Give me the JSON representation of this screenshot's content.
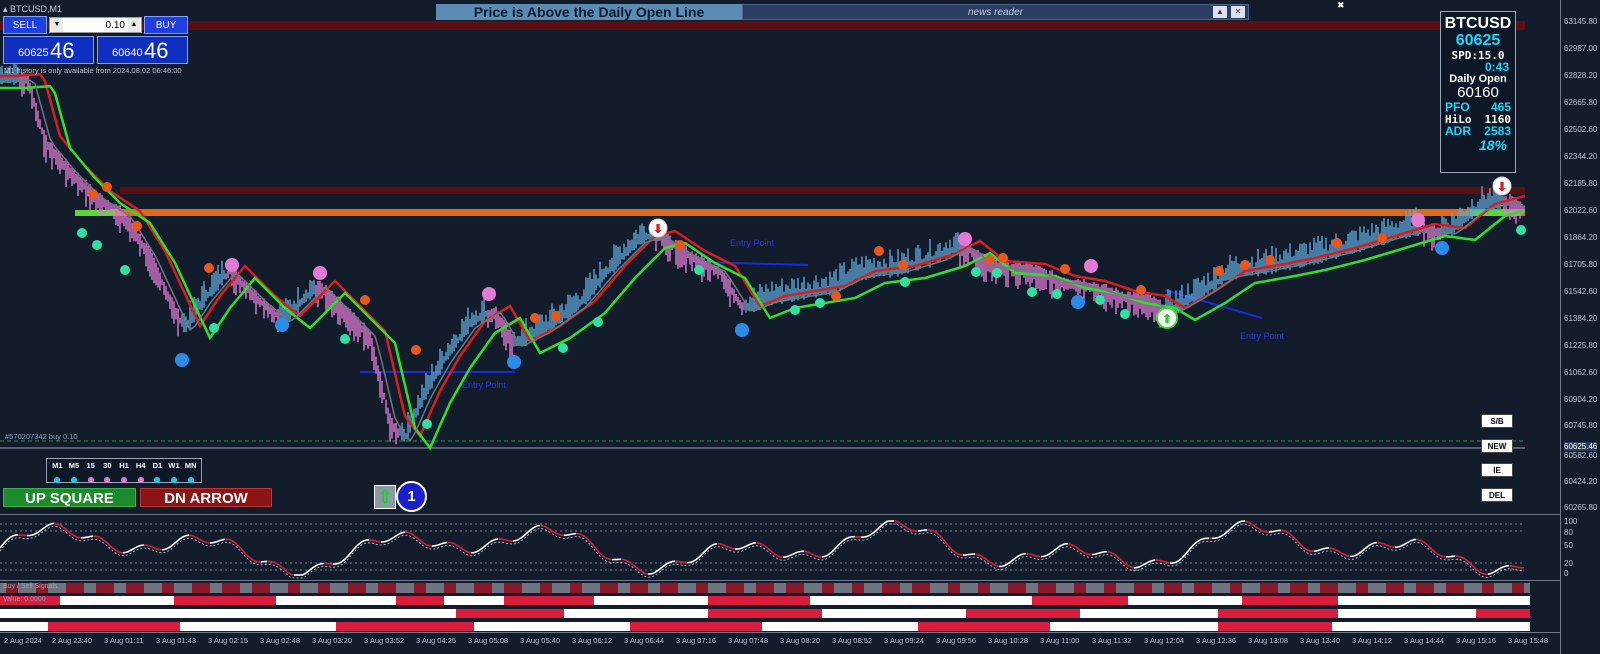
{
  "window": {
    "symbol_title": "BTCUSD,M1"
  },
  "trade_panel": {
    "sell_label": "SELL",
    "buy_label": "BUY",
    "lot_value": "0.10",
    "bid_small": "60625",
    "bid_big": "46",
    "ask_small": "60640",
    "ask_big": "46"
  },
  "history_note": "M1 history is only available from 2024.08.02 06:46:00",
  "banner_text": "Price is Above the Daily Open Line",
  "news_reader": {
    "title": "news reader",
    "collapse_icon": "caret-up-icon",
    "close_icon": "close-box-icon"
  },
  "info_panel": {
    "symbol": "BTCUSD",
    "price": "60625",
    "spread": "SPD:15.0",
    "time_left": "0:43",
    "daily_open_label": "Daily Open",
    "daily_open_value": "60160",
    "pfo_label": "PFO",
    "pfo_value": "465",
    "hilo_label": "HiLo",
    "hilo_value": "1160",
    "adr_label": "ADR",
    "adr_value": "2583",
    "adr_percent": "18%"
  },
  "side_buttons": [
    "S/B",
    "NEW",
    "IE",
    "DEL"
  ],
  "order_line_label": "#570207342 buy 0.10",
  "timeframes": [
    {
      "label": "M1",
      "color": "#1ec8e6"
    },
    {
      "label": "M5",
      "color": "#1ec8e6"
    },
    {
      "label": "15",
      "color": "#e27ad6"
    },
    {
      "label": "30",
      "color": "#e27ad6"
    },
    {
      "label": "H1",
      "color": "#e27ad6"
    },
    {
      "label": "H4",
      "color": "#e27ad6"
    },
    {
      "label": "D1",
      "color": "#1ec8e6"
    },
    {
      "label": "W1",
      "color": "#1ec8e6"
    },
    {
      "label": "MN",
      "color": "#1ec8e6"
    }
  ],
  "signals": {
    "up": "UP SQUARE",
    "dn": "DN ARROW",
    "count": "1"
  },
  "entry_labels": [
    "Entry Point",
    "Entry Point",
    "Entry Point"
  ],
  "price_axis": [
    "63145.80",
    "62987.00",
    "62828.20",
    "62665.80",
    "62502.60",
    "62344.20",
    "62185.80",
    "62022.60",
    "61864.20",
    "61705.80",
    "61542.60",
    "61384.20",
    "61225.80",
    "61062.60",
    "60904.20",
    "60745.80",
    "60625.46",
    "60582.60",
    "60424.20",
    "60265.80"
  ],
  "osc_axis": [
    "100",
    "80",
    "50",
    "20",
    "0"
  ],
  "strip_labels": [
    "Buy / Sell Signals",
    "Value: 0.0000"
  ],
  "time_axis": [
    "2 Aug 2024",
    "2 Aug 23:40",
    "3 Aug 01:11",
    "3 Aug 01:43",
    "3 Aug 02:15",
    "3 Aug 02:48",
    "3 Aug 03:20",
    "3 Aug 03:52",
    "3 Aug 04:25",
    "3 Aug 05:08",
    "3 Aug 05:40",
    "3 Aug 06:12",
    "3 Aug 06:44",
    "3 Aug 07:16",
    "3 Aug 07:48",
    "3 Aug 08:20",
    "3 Aug 08:52",
    "3 Aug 09:24",
    "3 Aug 09:56",
    "3 Aug 10:28",
    "3 Aug 11:00",
    "3 Aug 11:32",
    "3 Aug 12:04",
    "3 Aug 12:36",
    "3 Aug 13:08",
    "3 Aug 13:40",
    "3 Aug 14:12",
    "3 Aug 14:44",
    "3 Aug 15:16",
    "3 Aug 15:48"
  ],
  "colors": {
    "background": "#131c2b",
    "daily_open_line": "#e06a1a",
    "resistance_band": "#5a0f12",
    "green_ma": "#2fe02a",
    "red_ma": "#d81e1e",
    "bull_candle": "#5ea6d8",
    "bear_candle": "#e27ad6",
    "osc_line": "#ffffff",
    "osc_bear": "#d81e3c"
  }
}
